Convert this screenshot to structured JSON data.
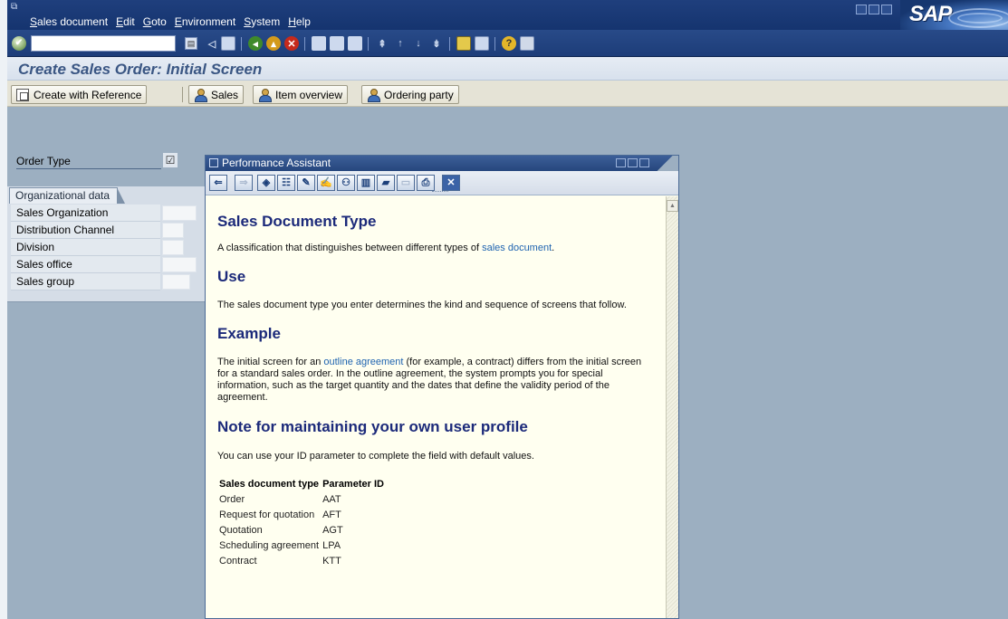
{
  "menubar": {
    "items": [
      "Sales document",
      "Edit",
      "Goto",
      "Environment",
      "System",
      "Help"
    ],
    "logo_text": "SAP"
  },
  "system_toolbar": {
    "command_field_value": "",
    "icons": [
      "enter-icon",
      "back-icon",
      "save-icon",
      "back-nav-icon",
      "exit-icon",
      "cancel-icon",
      "print-icon",
      "find-icon",
      "find-next-icon",
      "first-page-icon",
      "prev-page-icon",
      "next-page-icon",
      "last-page-icon",
      "new-session-icon",
      "shortcut-icon",
      "help-icon",
      "layout-icon"
    ]
  },
  "title": "Create Sales Order: Initial Screen",
  "app_toolbar": {
    "create_with_reference": "Create with Reference",
    "sales": "Sales",
    "item_overview": "Item overview",
    "ordering_party": "Ordering party"
  },
  "form": {
    "order_type_label": "Order Type",
    "order_type_check": "☑",
    "org_tab_label": "Organizational data",
    "org_fields": [
      {
        "label": "Sales Organization",
        "value": ""
      },
      {
        "label": "Distribution Channel",
        "value": ""
      },
      {
        "label": "Division",
        "value": ""
      },
      {
        "label": "Sales office",
        "value": ""
      },
      {
        "label": "Sales group",
        "value": ""
      }
    ]
  },
  "assistant": {
    "window_title": "Performance Assistant",
    "heading1": "Sales Document Type",
    "p1_before": "A classification that distinguishes between different types of ",
    "p1_link": "sales document",
    "p1_after": ".",
    "heading2": "Use",
    "p2": "The sales document type you enter determines the kind and sequence of screens that follow.",
    "heading3": "Example",
    "p3_before": "The initial screen for an ",
    "p3_link": "outline agreement",
    "p3_after": " (for example, a contract) differs from the initial screen for a standard sales order. In the outline agreement, the system prompts you for special information, such as the target quantity and the dates that define the validity period of the agreement.",
    "heading4": "Note for maintaining your own user profile",
    "p4": "You can use your ID parameter to complete the field with default values.",
    "table_headers": [
      "Sales document type",
      "Parameter ID"
    ],
    "table_rows": [
      [
        "Order",
        "AAT"
      ],
      [
        "Request for quotation",
        "AFT"
      ],
      [
        "Quotation",
        "AGT"
      ],
      [
        "Scheduling agreement",
        "LPA"
      ],
      [
        "Contract",
        "KTT"
      ]
    ]
  },
  "colors": {
    "menubar": "#1f3f7d",
    "title_text": "#3a5683",
    "background": "#9cafc1",
    "assistant_bg": "#fffff0",
    "heading_text": "#1c2a7a",
    "link": "#2064b0"
  }
}
